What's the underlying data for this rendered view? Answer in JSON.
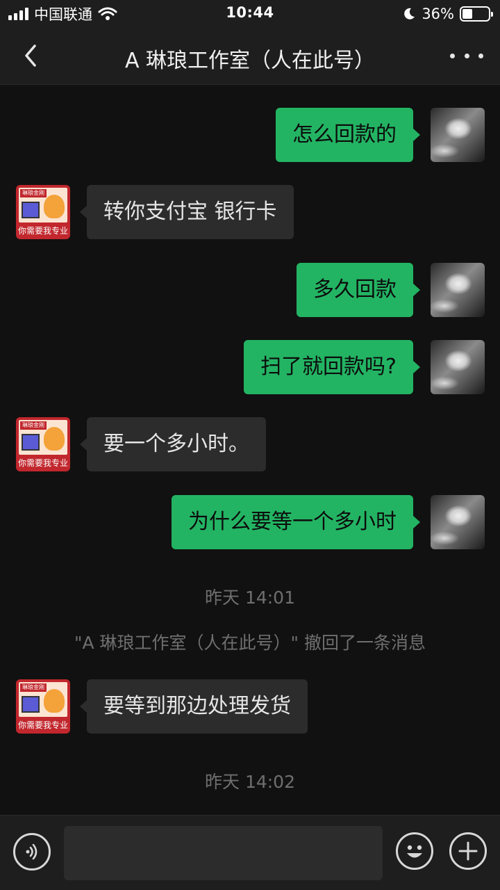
{
  "status_bar": {
    "carrier": "中国联通",
    "time": "10:44",
    "battery_percent": "36%",
    "battery_level": 0.36,
    "icons": [
      "signal-icon",
      "wifi-icon",
      "moon-icon",
      "battery-icon"
    ]
  },
  "nav": {
    "title": "A 琳琅工作室（人在此号）",
    "back_icon": "chevron-left-icon",
    "more_icon": "more-dots-icon"
  },
  "messages": [
    {
      "from": "me",
      "text": "怎么回款的"
    },
    {
      "from": "other",
      "text": "转你支付宝 银行卡"
    },
    {
      "from": "me",
      "text": "多久回款"
    },
    {
      "from": "me",
      "text": "扫了就回款吗?"
    },
    {
      "from": "other",
      "text": "要一个多小时。"
    },
    {
      "from": "me",
      "text": "为什么要等一个多小时"
    },
    {
      "from": "system",
      "text": "昨天 14:01"
    },
    {
      "from": "system",
      "text": "\"A 琳琅工作室（人在此号）\" 撤回了一条消息"
    },
    {
      "from": "other",
      "text": "要等到那边处理发货"
    },
    {
      "from": "system",
      "text": "昨天 14:02"
    }
  ],
  "contact_avatar": {
    "tag": "琳琅金刚",
    "slogan": "你需要我专业"
  },
  "input_bar": {
    "placeholder": "",
    "icons": [
      "voice-icon",
      "emoji-icon",
      "plus-icon"
    ]
  },
  "colors": {
    "outgoing_bubble": "#23b463",
    "incoming_bubble": "#2c2c2c",
    "background": "#111111",
    "bars": "#1e1e1e",
    "system_text": "#6f6f6f"
  }
}
